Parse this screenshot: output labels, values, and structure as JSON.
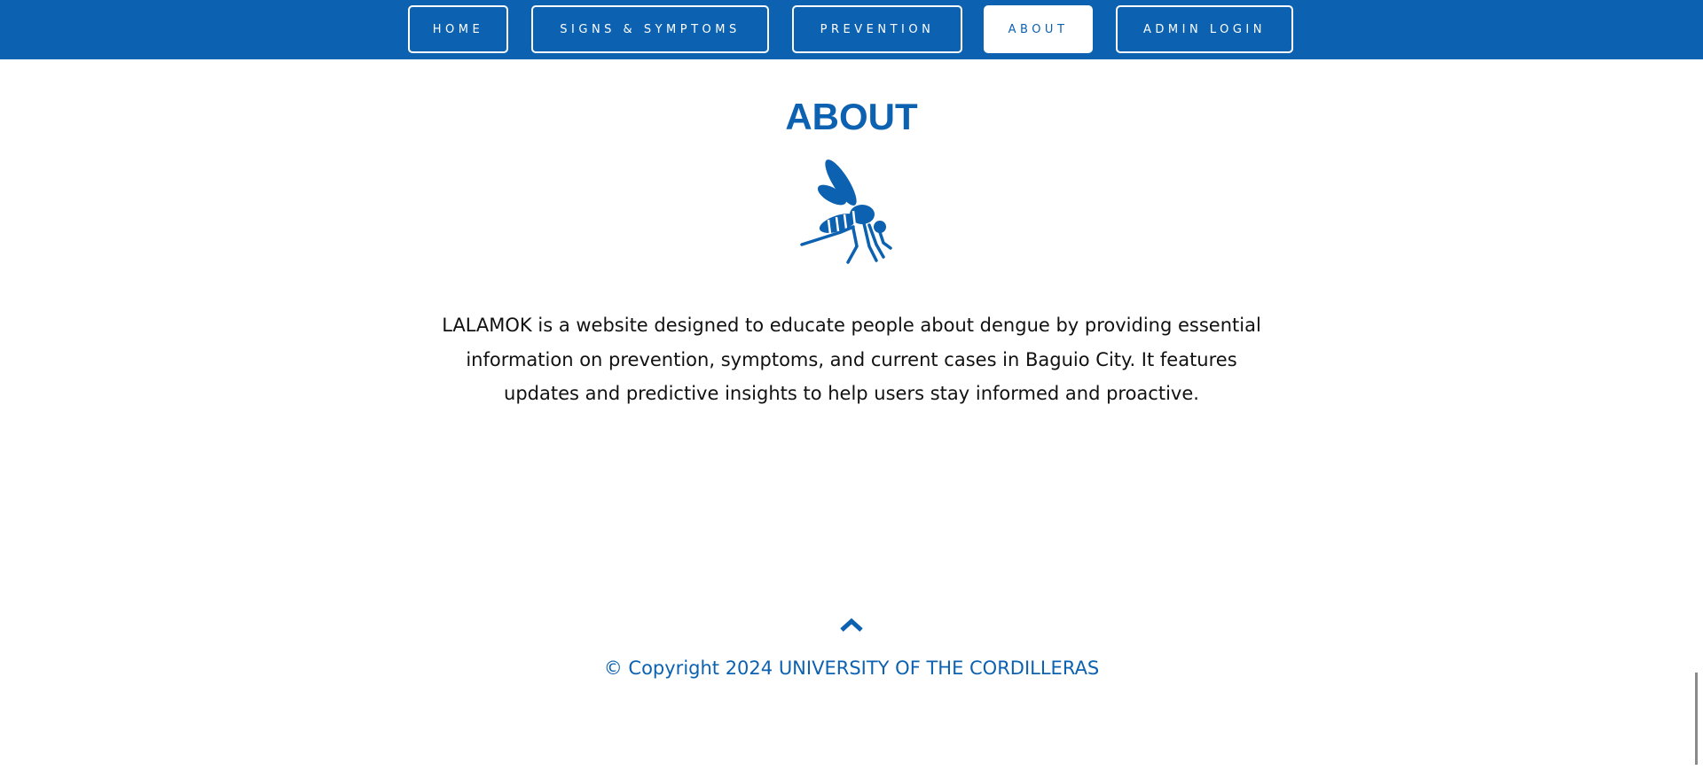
{
  "nav": {
    "items": [
      {
        "label": "HOME",
        "active": false
      },
      {
        "label": "SIGNS & SYMPTOMS",
        "active": false
      },
      {
        "label": "PREVENTION",
        "active": false
      },
      {
        "label": "ABOUT",
        "active": true
      },
      {
        "label": "ADMIN LOGIN",
        "active": false
      }
    ]
  },
  "main": {
    "title": "ABOUT",
    "icon": "mosquito-icon",
    "description": "LALAMOK is a website designed to educate people about dengue by providing essential information on prevention, symptoms, and current cases in Baguio City. It features updates and predictive insights to help users stay informed and proactive."
  },
  "footer": {
    "back_to_top_icon": "chevron-up-icon",
    "copyright": "© Copyright 2024 UNIVERSITY OF THE CORDILLERAS"
  },
  "colors": {
    "brand": "#0c61b0",
    "background": "#ffffff",
    "text": "#111111"
  }
}
